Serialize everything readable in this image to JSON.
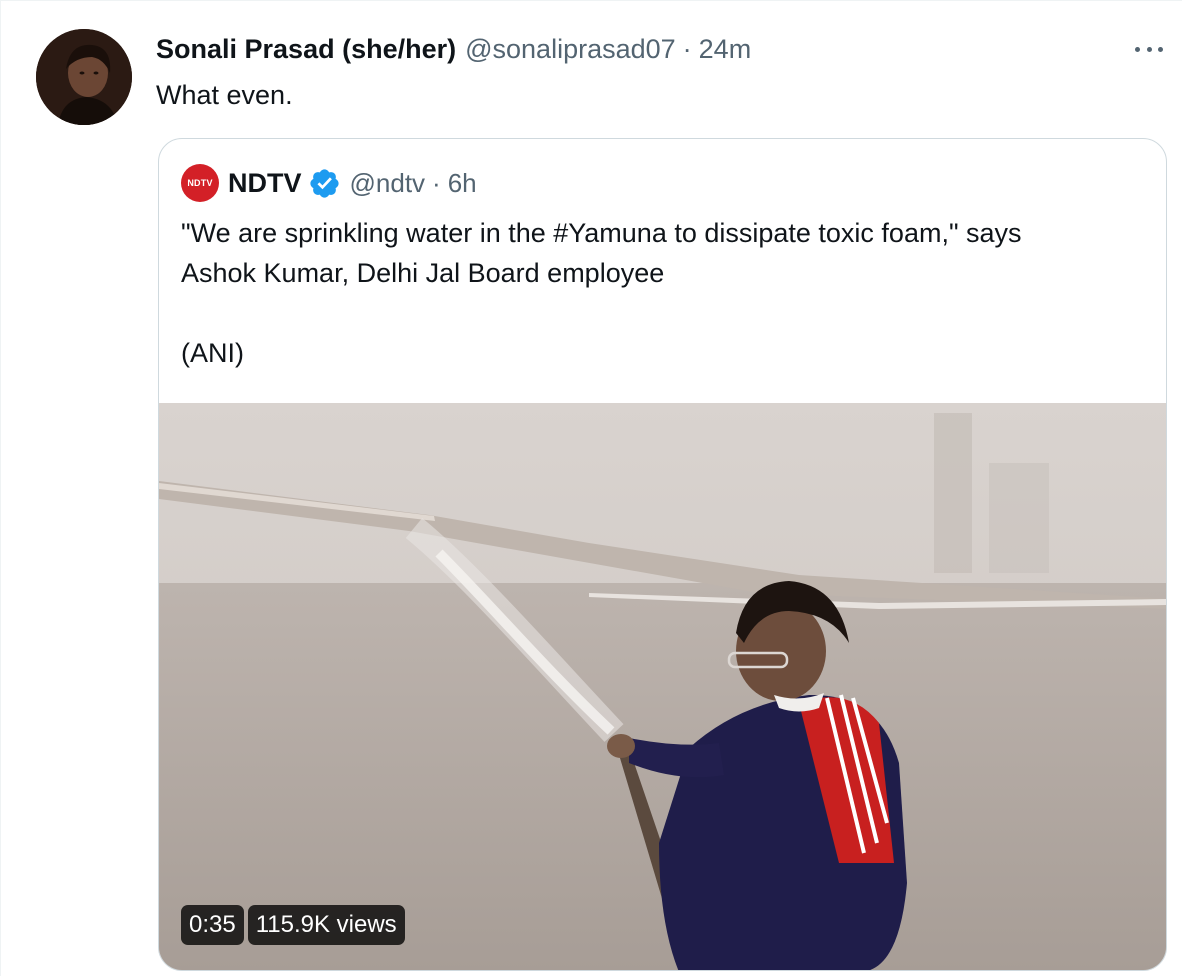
{
  "tweet": {
    "display_name": "Sonali Prasad (she/her)",
    "handle": "@sonaliprasad07",
    "separator": "·",
    "time": "24m",
    "text": "What even.",
    "avatar_icon": "user-avatar"
  },
  "quoted_tweet": {
    "logo_text": "NDTV",
    "display_name": "NDTV",
    "verified_icon": "verified-badge-icon",
    "handle": "@ndtv",
    "separator": "·",
    "time": "6h",
    "text_line_1": "\"We are sprinkling water in the #Yamuna to dissipate toxic foam,\" says",
    "text_line_2": "Ashok Kumar, Delhi Jal Board employee",
    "text_line_3": "(ANI)",
    "video": {
      "duration": "0:35",
      "views": "115.9K views"
    }
  },
  "colors": {
    "secondary_text": "#536471",
    "verified": "#1d9bf0",
    "ndtv_red": "#d32027",
    "border": "#cfd9de"
  }
}
